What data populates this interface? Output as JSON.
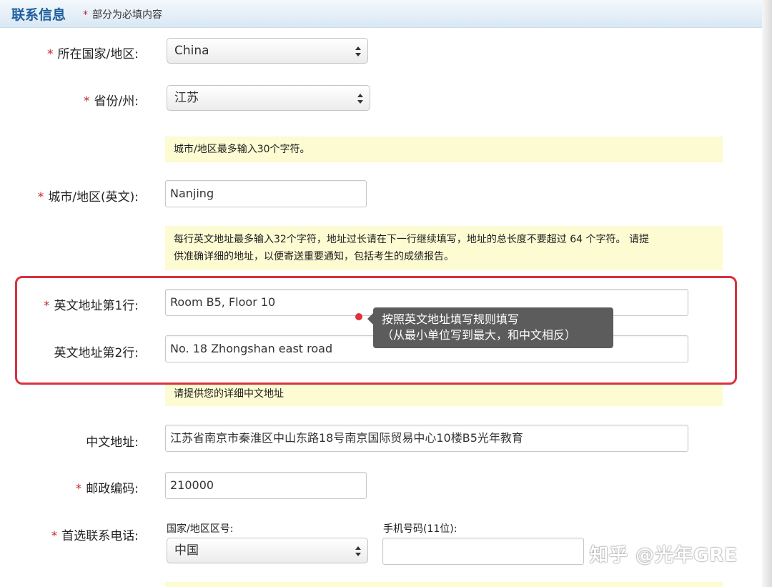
{
  "header": {
    "title": "联系信息",
    "required_marker": "*",
    "note": "部分为必填内容"
  },
  "form": {
    "country": {
      "marker": "*",
      "label": "所在国家/地区:",
      "value": "China"
    },
    "province": {
      "marker": "*",
      "label": "省份/州:",
      "value": "江苏"
    },
    "city_hint": "城市/地区最多输入30个字符。",
    "city": {
      "marker": "*",
      "label": "城市/地区(英文):",
      "value": "Nanjing"
    },
    "address_hint_line1": "每行英文地址最多输入32个字符，地址过长请在下一行继续填写，地址的总长度不要超过 64 个字符。 请提",
    "address_hint_line2": "供准确详细的地址，以便寄送重要通知，包括考生的成绩报告。",
    "address1": {
      "marker": "*",
      "label": "英文地址第1行:",
      "value": "Room B5, Floor 10"
    },
    "address2": {
      "label": "英文地址第2行:",
      "value": "No. 18 Zhongshan east road"
    },
    "chinese_hint": "请提供您的详细中文地址",
    "chinese_address": {
      "label": "中文地址:",
      "value": "江苏省南京市秦淮区中山东路18号南京国际贸易中心10楼B5光年教育"
    },
    "postal": {
      "marker": "*",
      "label": "邮政编码:",
      "value": "210000"
    },
    "phone": {
      "marker": "*",
      "label": "首选联系电话:",
      "country_code_label": "国家/地区区号:",
      "country_code_value": "中国",
      "mobile_label": "手机号码(11位):",
      "mobile_value": ""
    }
  },
  "tooltip": {
    "line1": "按照英文地址填写规则填写",
    "line2": "（从最小单位写到最大，和中文相反）"
  },
  "watermark": "知乎 @光年GRE",
  "colors": {
    "accent": "#1f5f9e",
    "required": "#c0282c",
    "highlight": "#d8323e",
    "hint_bg": "#fcfbd2"
  }
}
